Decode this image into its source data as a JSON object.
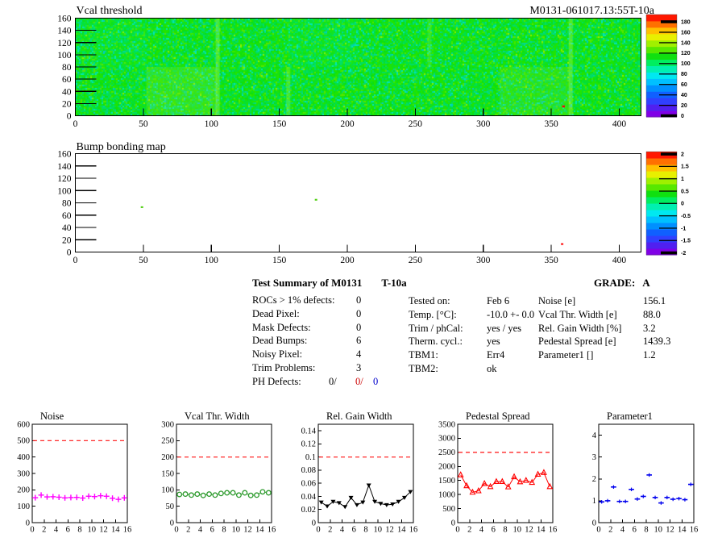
{
  "page_bg": "#ffffff",
  "palette_bottom_to_top": [
    "#8000e6",
    "#5020f0",
    "#3040ff",
    "#1060ff",
    "#0090ff",
    "#00c0ff",
    "#00e8f0",
    "#00f0b0",
    "#00ee60",
    "#10e010",
    "#58e800",
    "#a0f000",
    "#e8f000",
    "#ffc000",
    "#ff7000",
    "#ff1800"
  ],
  "summary": {
    "title": "Test Summary of M0131",
    "title_suffix": "T-10a",
    "grade_label": "GRADE:",
    "grade_value": "A",
    "defects": [
      {
        "label": "ROCs > 1% defects:",
        "value": "0"
      },
      {
        "label": "Dead Pixel:",
        "value": "0"
      },
      {
        "label": "Mask Defects:",
        "value": "0"
      },
      {
        "label": "Dead Bumps:",
        "value": "6"
      },
      {
        "label": "Noisy Pixel:",
        "value": "4"
      },
      {
        "label": "Trim Problems:",
        "value": "3"
      }
    ],
    "ph_defects": {
      "label": "PH Defects:",
      "black": "0/",
      "red": "0/",
      "blue": "0",
      "red_color": "#cc0000",
      "blue_color": "#0000cc"
    },
    "conditions": [
      {
        "label": "Tested on:",
        "value": "Feb 6"
      },
      {
        "label": "Temp. [°C]:",
        "value": "-10.0 +- 0.0"
      },
      {
        "label": "Trim / phCal:",
        "value": "yes / yes"
      },
      {
        "label": "Therm. cycl.:",
        "value": "yes"
      },
      {
        "label": "TBM1:",
        "value": "Err4"
      },
      {
        "label": "TBM2:",
        "value": "ok"
      }
    ],
    "results": [
      {
        "label": "Noise [e]",
        "value": "156.1"
      },
      {
        "label": "Vcal Thr. Width [e]",
        "value": "88.0"
      },
      {
        "label": "Rel. Gain Width [%]",
        "value": "3.2"
      },
      {
        "label": "Pedestal Spread [e]",
        "value": "1439.3"
      },
      {
        "label": "Parameter1 []",
        "value": "1.2"
      }
    ]
  },
  "chart_data": [
    {
      "type": "heatmap",
      "title": "Vcal threshold",
      "right_title": "M0131-061017.13:55T-10a",
      "xlim": [
        0,
        416
      ],
      "ylim": [
        0,
        160
      ],
      "zlim": [
        0,
        180
      ],
      "x_ticks": [
        0,
        50,
        100,
        150,
        200,
        250,
        300,
        350,
        400
      ],
      "y_ticks": [
        0,
        20,
        40,
        60,
        80,
        100,
        120,
        140,
        160
      ],
      "colorbar_ticks": [
        0,
        20,
        40,
        60,
        80,
        100,
        120,
        140,
        160,
        180
      ],
      "colorbar_labels": [
        "0",
        "20",
        "40",
        "60",
        "80",
        "100",
        "120",
        "140",
        "160",
        "180"
      ],
      "z_typical": 105,
      "texture": {
        "common": [
          "#0ee00e",
          "#1ce307",
          "#00e04a",
          "#07e02c",
          "#22e500",
          "#00dd66"
        ],
        "uncommon": [
          "#00d892",
          "#3ee800",
          "#00e6b4",
          "#55e600"
        ],
        "rare": [
          "#8cef00",
          "#00c8c8"
        ],
        "patches": [
          {
            "x": 52,
            "y": 0,
            "w": 52,
            "h": 80,
            "color": "#b8f040",
            "alpha": 0.2
          },
          {
            "x": 312,
            "y": 0,
            "w": 52,
            "h": 80,
            "color": "#b8f040",
            "alpha": 0.14
          },
          {
            "x": 103,
            "y": 0,
            "w": 3,
            "h": 160,
            "color": "#d0ff60",
            "alpha": 0.3
          },
          {
            "x": 363,
            "y": 0,
            "w": 3,
            "h": 160,
            "color": "#d0ff60",
            "alpha": 0.3
          },
          {
            "x": 155,
            "y": 0,
            "w": 3,
            "h": 80,
            "color": "#d0ff60",
            "alpha": 0.25
          },
          {
            "x": 259,
            "y": 80,
            "w": 3,
            "h": 80,
            "color": "#d0ff60",
            "alpha": 0.18
          },
          {
            "x": 156,
            "y": 80,
            "w": 52,
            "h": 80,
            "color": "#00ffc8",
            "alpha": 0.07
          },
          {
            "x": 0,
            "y": 80,
            "w": 52,
            "h": 80,
            "color": "#00ffc8",
            "alpha": 0.07
          }
        ]
      },
      "defects": [
        {
          "x": 359,
          "y": 15,
          "color": "#ff0000"
        }
      ]
    },
    {
      "type": "heatmap",
      "title": "Bump bonding map",
      "xlim": [
        0,
        416
      ],
      "ylim": [
        0,
        160
      ],
      "zlim": [
        -2,
        2
      ],
      "x_ticks": [
        0,
        50,
        100,
        150,
        200,
        250,
        300,
        350,
        400
      ],
      "y_ticks": [
        0,
        20,
        40,
        60,
        80,
        100,
        120,
        140,
        160
      ],
      "colorbar_ticks": [
        -2,
        -1.5,
        -1,
        -0.5,
        0,
        0.5,
        1,
        1.5,
        2
      ],
      "colorbar_labels": [
        "-2",
        "-1.5",
        "-1",
        "-0.5",
        "0",
        "0.5",
        "1",
        "1.5",
        "2"
      ],
      "background": "#ffffff",
      "defects": [
        {
          "x": 49,
          "y": 73,
          "color": "#44cc00"
        },
        {
          "x": 177,
          "y": 85,
          "color": "#44cc00"
        },
        {
          "x": 358,
          "y": 13,
          "color": "#ff0000"
        }
      ]
    },
    {
      "type": "scatter",
      "title": "Noise",
      "x": [
        0.5,
        1.5,
        2.5,
        3.5,
        4.5,
        5.5,
        6.5,
        7.5,
        8.5,
        9.5,
        10.5,
        11.5,
        12.5,
        13.5,
        14.5,
        15.5
      ],
      "values": [
        152,
        168,
        157,
        158,
        155,
        151,
        153,
        154,
        150,
        161,
        159,
        164,
        161,
        149,
        142,
        151
      ],
      "yerr": 11,
      "xlim": [
        0,
        16
      ],
      "ylim": [
        0,
        600
      ],
      "x_ticks": [
        0,
        2,
        4,
        6,
        8,
        10,
        12,
        14,
        16
      ],
      "y_ticks": [
        0,
        100,
        200,
        300,
        400,
        500,
        600
      ],
      "y_tick_labels": [
        "0",
        "100",
        "200",
        "300",
        "400",
        "500",
        "600"
      ],
      "cut_line": 500,
      "cut_line_color": "#ff1111",
      "marker": "plus",
      "color": "#ff00ff",
      "connect": false
    },
    {
      "type": "line",
      "title": "Vcal Thr. Width",
      "x": [
        0.5,
        1.5,
        2.5,
        3.5,
        4.5,
        5.5,
        6.5,
        7.5,
        8.5,
        9.5,
        10.5,
        11.5,
        12.5,
        13.5,
        14.5,
        15.5
      ],
      "values": [
        86,
        87,
        84,
        87,
        83,
        87,
        84,
        89,
        91,
        91,
        84,
        91,
        83,
        84,
        94,
        91
      ],
      "xlim": [
        0,
        16
      ],
      "ylim": [
        0,
        300
      ],
      "x_ticks": [
        0,
        2,
        4,
        6,
        8,
        10,
        12,
        14,
        16
      ],
      "y_ticks": [
        0,
        50,
        100,
        150,
        200,
        250,
        300
      ],
      "y_tick_labels": [
        "0",
        "50",
        "100",
        "150",
        "200",
        "250",
        "300"
      ],
      "cut_line": 200,
      "cut_line_color": "#ff1111",
      "marker": "circle-open",
      "color": "#2e9b2e",
      "connect": true
    },
    {
      "type": "line",
      "title": "Rel. Gain Width",
      "x": [
        0.5,
        1.5,
        2.5,
        3.5,
        4.5,
        5.5,
        6.5,
        7.5,
        8.5,
        9.5,
        10.5,
        11.5,
        12.5,
        13.5,
        14.5,
        15.5
      ],
      "values": [
        0.031,
        0.025,
        0.032,
        0.03,
        0.024,
        0.038,
        0.027,
        0.031,
        0.057,
        0.032,
        0.029,
        0.027,
        0.028,
        0.032,
        0.038,
        0.047
      ],
      "xlim": [
        0,
        16
      ],
      "ylim": [
        0,
        0.15
      ],
      "x_ticks": [
        0,
        2,
        4,
        6,
        8,
        10,
        12,
        14,
        16
      ],
      "y_ticks": [
        0,
        0.02,
        0.04,
        0.06,
        0.08,
        0.1,
        0.12,
        0.14
      ],
      "y_tick_labels": [
        "0",
        "0.02",
        "0.04",
        "0.06",
        "0.08",
        "0.1",
        "0.12",
        "0.14"
      ],
      "cut_line": 0.1,
      "cut_line_color": "#ff1111",
      "marker": "triangle-down",
      "color": "#000000",
      "connect": true
    },
    {
      "type": "line",
      "title": "Pedestal Spread",
      "x": [
        0.5,
        1.5,
        2.5,
        3.5,
        4.5,
        5.5,
        6.5,
        7.5,
        8.5,
        9.5,
        10.5,
        11.5,
        12.5,
        13.5,
        14.5,
        15.5
      ],
      "values": [
        1700,
        1310,
        1080,
        1130,
        1390,
        1280,
        1460,
        1460,
        1270,
        1630,
        1450,
        1500,
        1430,
        1720,
        1780,
        1280
      ],
      "xlim": [
        0,
        16
      ],
      "ylim": [
        0,
        3500
      ],
      "x_ticks": [
        0,
        2,
        4,
        6,
        8,
        10,
        12,
        14,
        16
      ],
      "y_ticks": [
        0,
        500,
        1000,
        1500,
        2000,
        2500,
        3000,
        3500
      ],
      "y_tick_labels": [
        "0",
        "500",
        "1000",
        "1500",
        "2000",
        "2500",
        "3000",
        "3500"
      ],
      "cut_line": 2500,
      "cut_line_color": "#ff1111",
      "marker": "triangle-open",
      "color": "#ff0000",
      "connect": true
    },
    {
      "type": "scatter",
      "title": "Parameter1",
      "x": [
        0.5,
        1.5,
        2.5,
        3.5,
        4.5,
        5.5,
        6.5,
        7.5,
        8.5,
        9.5,
        10.5,
        11.5,
        12.5,
        13.5,
        14.5,
        15.5
      ],
      "values": [
        0.95,
        1.0,
        1.63,
        0.97,
        0.97,
        1.52,
        1.08,
        1.2,
        2.18,
        1.15,
        0.9,
        1.15,
        1.07,
        1.1,
        1.05,
        1.75
      ],
      "xerr": 0.45,
      "xlim": [
        0,
        16
      ],
      "ylim": [
        0,
        4.5
      ],
      "x_ticks": [
        0,
        2,
        4,
        6,
        8,
        10,
        12,
        14,
        16
      ],
      "y_ticks": [
        0,
        1,
        2,
        3,
        4
      ],
      "y_tick_labels": [
        "0",
        "1",
        "2",
        "3",
        "4"
      ],
      "cut_line": null,
      "marker": "hbar",
      "color": "#0000ee",
      "connect": false
    }
  ]
}
